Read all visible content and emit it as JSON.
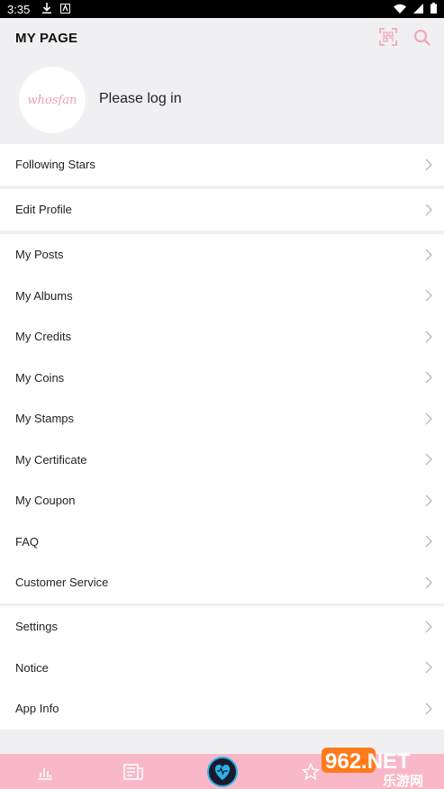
{
  "status_bar": {
    "time": "3:35"
  },
  "header": {
    "title": "MY PAGE",
    "login_prompt": "Please log in",
    "avatar_logo": "whosfan"
  },
  "groups": [
    {
      "items": [
        "Following Stars"
      ]
    },
    {
      "items": [
        "Edit Profile"
      ]
    },
    {
      "items": [
        "My Posts",
        "My Albums",
        "My Credits",
        "My Coins",
        "My Stamps",
        "My Certificate",
        "My Coupon",
        "FAQ",
        "Customer Service"
      ]
    },
    {
      "items": [
        "Settings",
        "Notice",
        "App Info"
      ]
    }
  ],
  "bottom_nav": {
    "items": [
      "chart-icon",
      "news-icon",
      "hmd-logo-icon",
      "star-icon"
    ],
    "accent": "#f8b8c8"
  },
  "watermark": {
    "text": "962.NET",
    "subtext": "乐游网"
  },
  "colors": {
    "icon_pink": "#f4a7b9",
    "background": "#f0f0f2",
    "chevron": "#bbbbbb"
  }
}
